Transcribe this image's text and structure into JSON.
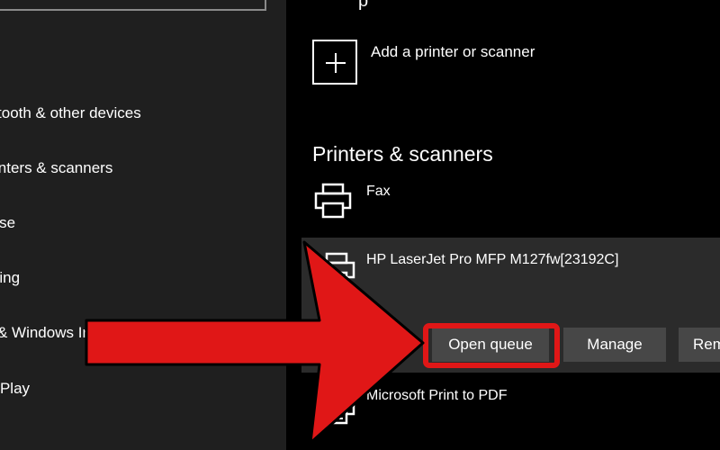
{
  "sidebar": {
    "items": [
      {
        "label": "Bluetooth & other devices"
      },
      {
        "label": "Printers & scanners"
      },
      {
        "label": "Mouse"
      },
      {
        "label": "Typing"
      },
      {
        "label": "Pen & Windows Ink"
      },
      {
        "label": "AutoPlay"
      }
    ]
  },
  "main": {
    "header_fragment": "p",
    "add_label": "Add a printer or scanner",
    "section_title": "Printers & scanners",
    "printers": [
      {
        "name": "Fax",
        "icon": "printer-icon"
      },
      {
        "name": "HP LaserJet Pro MFP M127fw[23192C]",
        "icon": "printer-icon"
      },
      {
        "name": "Microsoft Print to PDF",
        "icon": "printer-icon"
      }
    ],
    "buttons": {
      "open_queue": "Open queue",
      "manage": "Manage",
      "remove": "Remove"
    }
  },
  "annotation": {
    "arrow_color": "#e01717",
    "highlight_color": "#e01717"
  }
}
